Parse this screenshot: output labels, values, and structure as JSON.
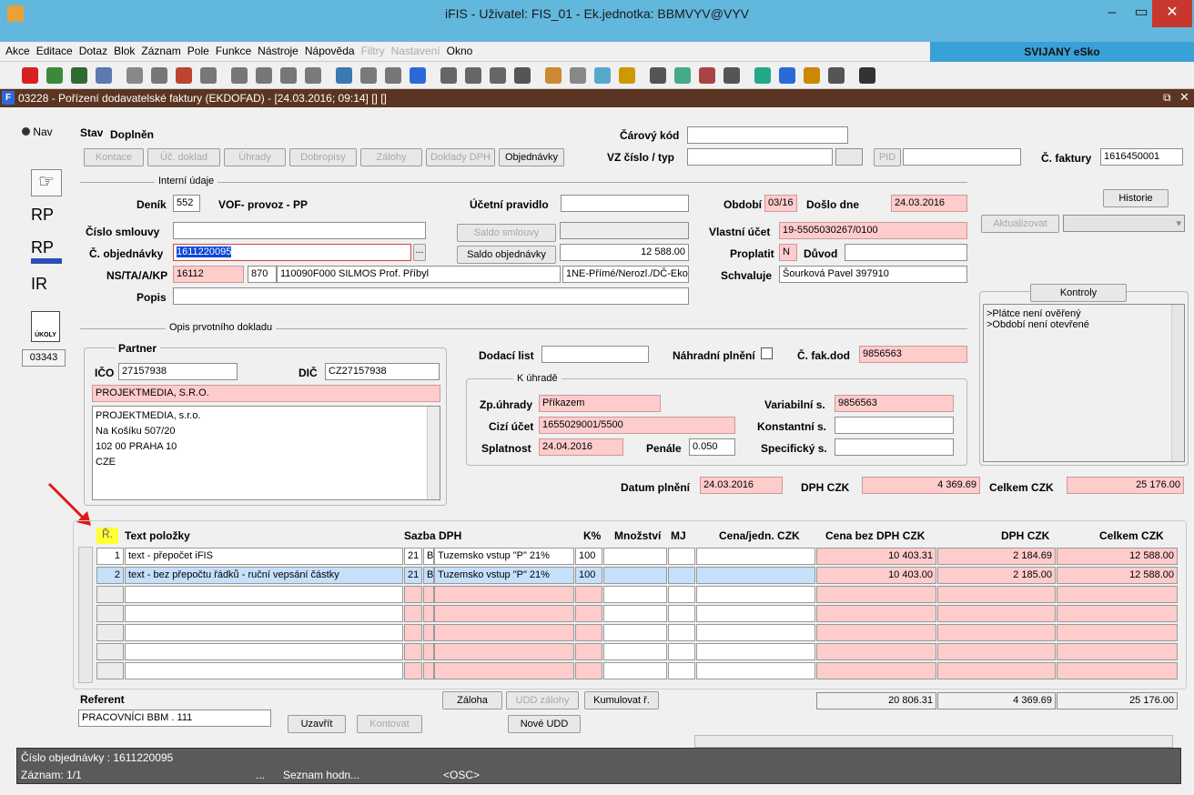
{
  "window": {
    "title": "iFIS - Uživatel: FIS_01 - Ek.jednotka: BBMVYV@VYV"
  },
  "menu": {
    "items": [
      "Akce",
      "Editace",
      "Dotaz",
      "Blok",
      "Záznam",
      "Pole",
      "Funkce",
      "Nástroje",
      "Nápověda",
      "Filtry",
      "Nastavení",
      "Okno"
    ],
    "brand": "SVIJANY eSko"
  },
  "form": {
    "title": "03228 - Pořízení dodavatelské faktury (EKDOFAD) - [24.03.2016; 09:14] [] []"
  },
  "left": {
    "nav": "Nav",
    "rp1": "RP",
    "rp2": "RP",
    "ir": "IR",
    "ukoly": "ÚKOLY",
    "count": "03343"
  },
  "header": {
    "stav_label": "Stav",
    "stav_value": "Doplněn",
    "carovy_kod_label": "Čárový kód",
    "carovy_kod": "",
    "vz_label": "VZ číslo / typ",
    "pid_label": "PID",
    "cislo_faktury_label": "Č. faktury",
    "cislo_faktury": "1616450001"
  },
  "tabs": [
    "Kontace",
    "Úč. doklad",
    "Úhrady",
    "Dobropisy",
    "Zálohy",
    "Doklady DPH",
    "Objednávky"
  ],
  "interni": {
    "section": "Interní údaje",
    "denik_label": "Deník",
    "denik": "552",
    "denik_text": "VOF- provoz - PP",
    "ucetni_pravidlo_label": "Účetní pravidlo",
    "ucetni_pravidlo": "",
    "obdobi_label": "Období",
    "obdobi": "03/16",
    "doslo_label": "Došlo dne",
    "doslo": "24.03.2016",
    "historie": "Historie",
    "cislo_smlouvy_label": "Číslo smlouvy",
    "cislo_smlouvy": "",
    "saldo_smlouvy": "Saldo smlouvy",
    "vlastni_ucet_label": "Vlastní účet",
    "vlastni_ucet": "19-5505030267/0100",
    "aktualizovat": "Aktualizovat",
    "cislo_obj_label": "Č. objednávky",
    "cislo_obj": "1611220095",
    "lookup": "...",
    "saldo_obj": "Saldo objednávky",
    "saldo_obj_value": "12 588.00",
    "proplatit_label": "Proplatit",
    "proplatit": "N",
    "duvod_label": "Důvod",
    "duvod": "",
    "ns_label": "NS/TA/A/KP",
    "ns": "16112",
    "ta": "870",
    "a": "110090F000 SILMOS Prof. Příbyl",
    "kp": "1NE-Přímé/Nerozl./DČ-Eko",
    "schvaluje_label": "Schvaluje",
    "schvaluje": "Šourková Pavel 397910",
    "popis_label": "Popis",
    "popis": ""
  },
  "kontroly": {
    "button": "Kontroly",
    "lines": [
      ">Plátce není ověřený",
      ">Období není otevřené"
    ]
  },
  "opis": {
    "section": "Opis prvotního dokladu",
    "partner": "Partner",
    "ico_label": "IČO",
    "ico": "27157938",
    "dic_label": "DIČ",
    "dic": "CZ27157938",
    "name": "PROJEKTMEDIA, S.R.O.",
    "address": [
      "PROJEKTMEDIA, s.r.o.",
      "Na Košíku 507/20",
      "102 00 PRAHA 10",
      "CZE"
    ],
    "dodaci_label": "Dodací list",
    "dodaci": "",
    "nahradni_label": "Náhradní plnění",
    "cfak_label": "Č. fak.dod",
    "cfak": "9856563"
  },
  "uhrada": {
    "section": "K úhradě",
    "zp_label": "Zp.úhrady",
    "zp": "Příkazem",
    "var_label": "Variabilní s.",
    "var": "9856563",
    "cizi_label": "Cizí účet",
    "cizi": "1655029001/5500",
    "konst_label": "Konstantní s.",
    "konst": "",
    "splat_label": "Splatnost",
    "splat": "24.04.2016",
    "penale_label": "Penále",
    "penale": "0.050",
    "spec_label": "Specifický s.",
    "spec": ""
  },
  "totals": {
    "datum_label": "Datum plnění",
    "datum": "24.03.2016",
    "dph_label": "DPH CZK",
    "dph": "4 369.69",
    "celkem_label": "Celkem CZK",
    "celkem": "25 176.00"
  },
  "grid": {
    "headers": {
      "r": "Ř.",
      "text": "Text položky",
      "sazba": "Sazba DPH",
      "k": "K%",
      "mnozstvi": "Množství",
      "mj": "MJ",
      "cena": "Cena/jedn.",
      "cena_unit": "CZK",
      "bez": "Cena bez DPH",
      "bez_unit": "CZK",
      "dph": "DPH",
      "dph_unit": "CZK",
      "celkem": "Celkem",
      "celkem_unit": "CZK"
    },
    "rows": [
      {
        "n": "1",
        "text": "text - přepočet iFIS",
        "sazba": "21",
        "typ": "B",
        "sazba_text": "Tuzemsko vstup \"P\" 21%",
        "k": "100",
        "bez": "10 403.31",
        "dph": "2 184.69",
        "celkem": "12 588.00"
      },
      {
        "n": "2",
        "text": "text - bez přepočtu řádků - ruční vepsání částky",
        "sazba": "21",
        "typ": "B",
        "sazba_text": "Tuzemsko vstup \"P\" 21%",
        "k": "100",
        "bez": "10 403.00",
        "dph": "2 185.00",
        "celkem": "12 588.00"
      }
    ],
    "sum_bez": "20 806.31",
    "sum_dph": "4 369.69",
    "sum_celkem": "25 176.00"
  },
  "bottom": {
    "referent_label": "Referent",
    "referent": "PRACOVNÍCI BBM . 111",
    "uzavrit": "Uzavřít",
    "kontovat": "Kontovat",
    "zaloha": "Záloha",
    "udd_zalohy": "UDD zálohy",
    "kumulovat": "Kumulovat ř.",
    "nove_udd": "Nové UDD"
  },
  "status": {
    "line1": "Číslo objednávky : 1611220095",
    "zaznam": "Záznam: 1/1",
    "dots": "...",
    "seznam": "Seznam hodn...",
    "osc": "<OSC>"
  }
}
